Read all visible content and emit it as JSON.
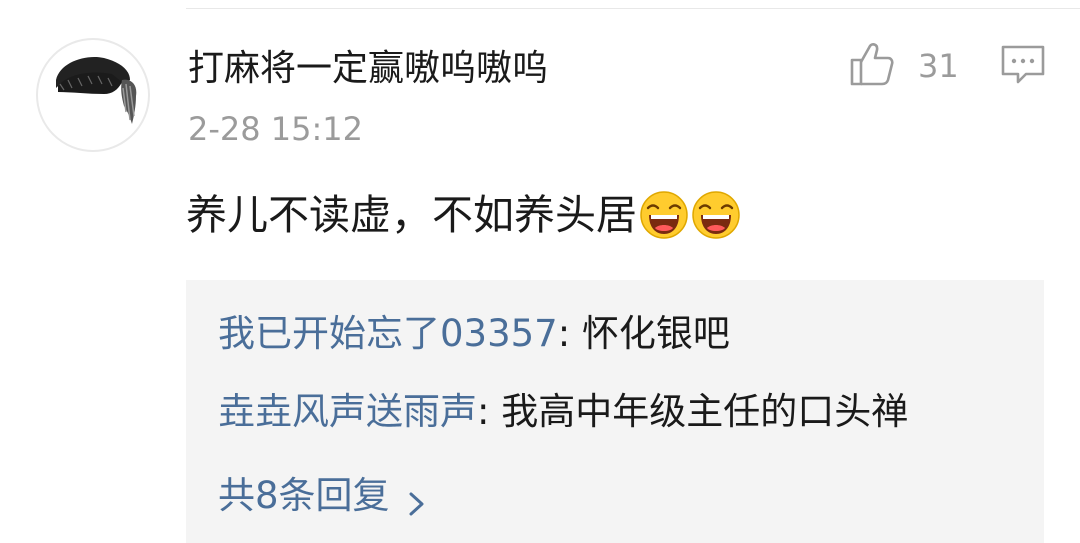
{
  "comment": {
    "avatar_icon": "hair-avatar",
    "username": "打麻将一定赢嗷呜嗷呜",
    "timestamp": "2-28 15:12",
    "like_icon": "thumbs-up-icon",
    "like_count": "31",
    "reply_icon": "comment-bubble-icon",
    "text": "养儿不读虚，不如养头居",
    "emojis": [
      "laughing-face-emoji",
      "laughing-face-emoji"
    ]
  },
  "replies": {
    "items": [
      {
        "user": "我已开始忘了03357",
        "separator": ": ",
        "text": "怀化银吧"
      },
      {
        "user": "垚垚风声送雨声",
        "separator": ": ",
        "text": "我高中年级主任的口头禅"
      }
    ],
    "more_label": "共8条回复",
    "more_icon": "chevron-right-icon"
  },
  "colors": {
    "username": "#1a1a1a",
    "meta": "#9b9b9b",
    "link": "#4a6e99",
    "reply_bg": "#f4f4f4"
  }
}
